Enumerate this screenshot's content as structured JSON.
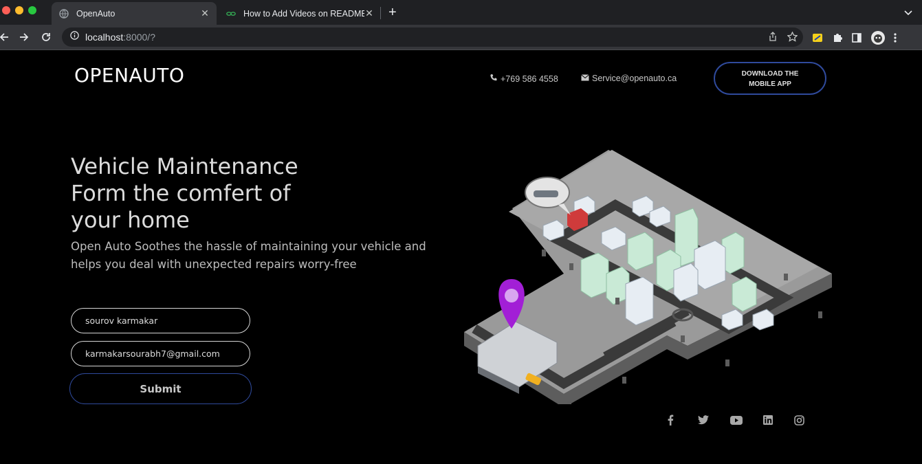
{
  "browser": {
    "tabs": [
      {
        "title": "OpenAuto",
        "active": true
      },
      {
        "title": "How to Add Videos on README",
        "active": false
      }
    ],
    "url_host": "localhost",
    "url_rest": ":8000/?"
  },
  "header": {
    "logo": "OPENAUTO",
    "phone": "+769 586 4558",
    "email": "Service@openauto.ca",
    "download_line1": "DOWNLOAD THE",
    "download_line2": "MOBILE APP"
  },
  "hero": {
    "title_line1": "Vehicle Maintenance",
    "title_line2": "Form the comfert of",
    "title_line3": "your home",
    "subtitle": "Open Auto Soothes the hassle of maintaining your vehicle and helps you deal with unexpected repairs worry-free"
  },
  "form": {
    "name_value": "sourov karmakar",
    "email_value": "karmakarsourabh7@gmail.com",
    "submit_label": "Submit"
  },
  "social": [
    "facebook-icon",
    "twitter-icon",
    "youtube-icon",
    "linkedin-icon",
    "instagram-icon"
  ],
  "colors": {
    "background": "#000000",
    "accent_border": "#2f4a9c",
    "pin": "#a21fd6"
  }
}
